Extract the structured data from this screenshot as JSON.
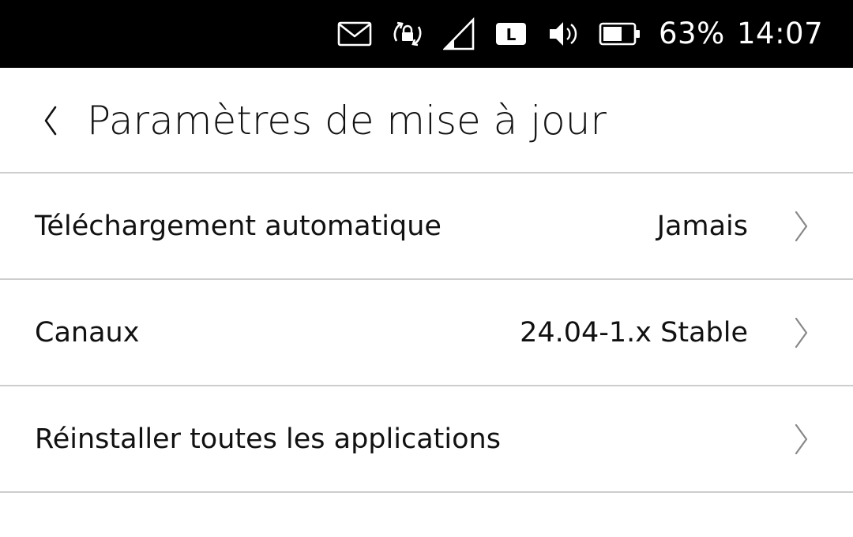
{
  "status_bar": {
    "icons": [
      "envelope-icon",
      "rotation-lock-icon",
      "cellular-signal-icon",
      "lte-badge-icon",
      "volume-icon",
      "battery-icon"
    ],
    "lte_label": "L",
    "battery_percent": "63%",
    "time": "14:07",
    "battery_level": 0.63
  },
  "header": {
    "back_icon": "chevron-left-icon",
    "title": "Paramètres de mise à jour"
  },
  "settings": {
    "items": [
      {
        "label": "Téléchargement automatique",
        "value": "Jamais",
        "icon": "chevron-right-icon"
      },
      {
        "label": "Canaux",
        "value": "24.04-1.x Stable",
        "icon": "chevron-right-icon"
      },
      {
        "label": "Réinstaller toutes les applications",
        "value": "",
        "icon": "chevron-right-icon"
      }
    ]
  },
  "colors": {
    "status_bar_bg": "#000000",
    "background": "#ffffff",
    "divider": "#cdcdcd",
    "text": "#111111",
    "chevron": "#888888"
  }
}
